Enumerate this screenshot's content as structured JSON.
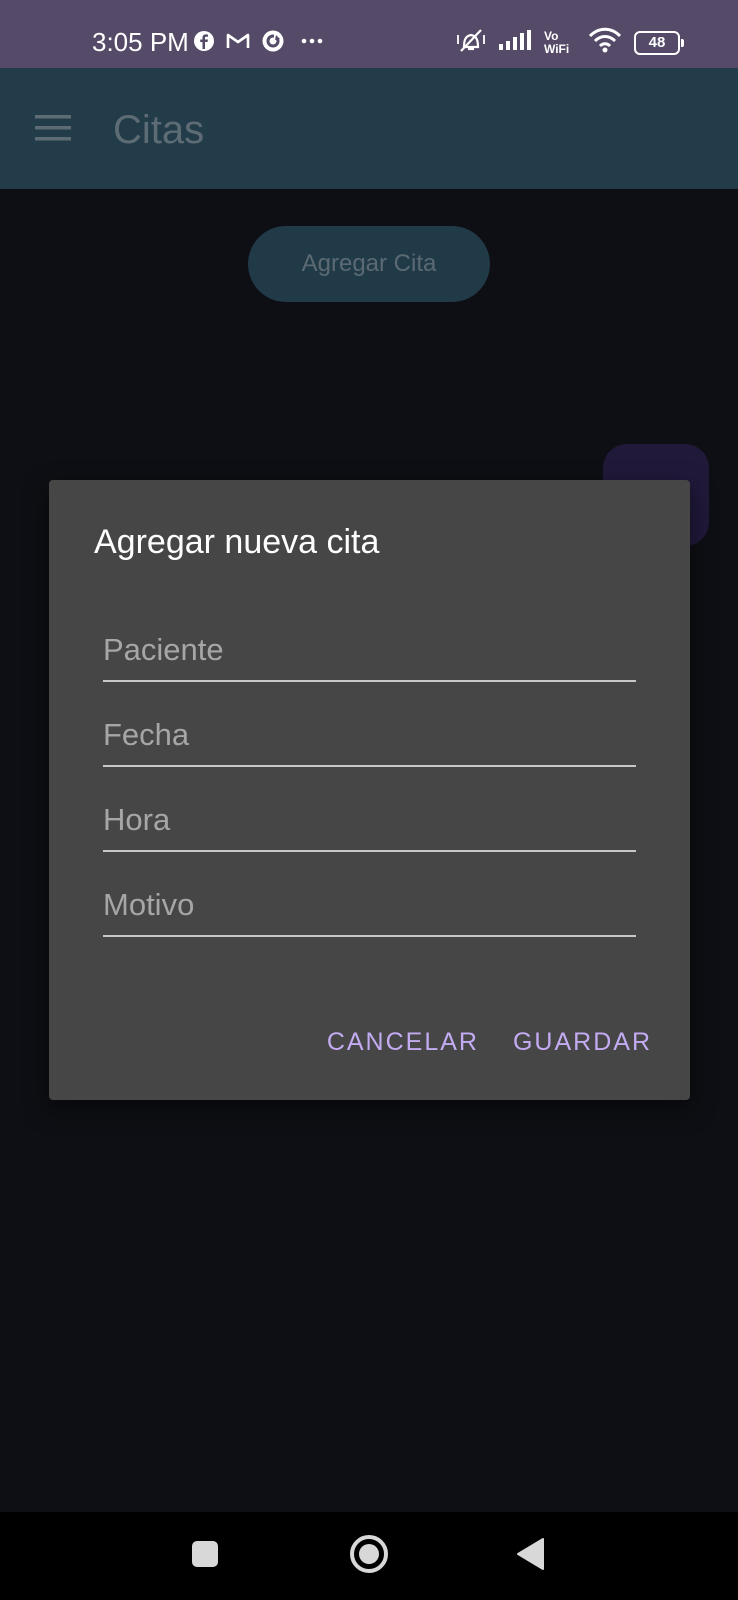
{
  "status_bar": {
    "time": "3:05 PM",
    "left_icons": [
      "facebook-icon",
      "gmail-icon",
      "sync-app-icon",
      "more-dots-icon"
    ],
    "right_icons": [
      "vibrate-off-icon",
      "signal-icon",
      "vowifi-icon",
      "wifi-icon",
      "battery-icon"
    ],
    "vowifi_line1": "Vo",
    "vowifi_line2": "WiFi",
    "battery_level": "48"
  },
  "app_bar": {
    "title": "Citas",
    "menu_icon": "menu-icon"
  },
  "content": {
    "add_button_label": "Agregar Cita"
  },
  "dialog": {
    "title": "Agregar nueva cita",
    "fields": [
      {
        "placeholder": "Paciente",
        "value": ""
      },
      {
        "placeholder": "Fecha",
        "value": ""
      },
      {
        "placeholder": "Hora",
        "value": ""
      },
      {
        "placeholder": "Motivo",
        "value": ""
      }
    ],
    "cancel_label": "CANCELAR",
    "save_label": "GUARDAR"
  },
  "nav_bar": {
    "buttons": [
      "recents-icon",
      "home-icon",
      "back-icon"
    ]
  },
  "colors": {
    "status_bar": "#554a68",
    "app_bar": "#233c4a",
    "background": "#0e0f14",
    "dialog": "#464646",
    "accent": "#c3abf2"
  }
}
